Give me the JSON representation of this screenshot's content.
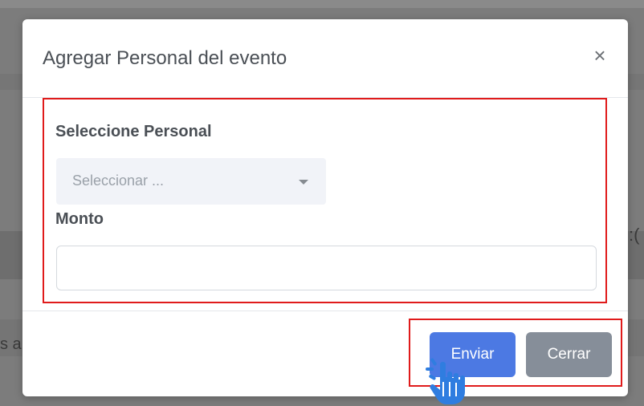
{
  "background": {
    "right_edge_text": ":(",
    "left_edge_text": "s a"
  },
  "modal": {
    "title": "Agregar Personal del evento",
    "close_glyph": "×"
  },
  "form": {
    "personal_label": "Seleccione Personal",
    "personal_select": {
      "placeholder": "Seleccionar ..."
    },
    "monto_label": "Monto",
    "monto_input": {
      "value": ""
    }
  },
  "footer": {
    "send_label": "Enviar",
    "close_label": "Cerrar"
  },
  "colors": {
    "highlight_frame": "#e01b1b",
    "primary_button": "#4c79e3",
    "secondary_button": "#868e99",
    "cursor": "#2f7de0"
  },
  "icons": {
    "close": "close-icon",
    "select_caret": "chevron-down-icon",
    "cursor": "hand-pointer-icon"
  }
}
